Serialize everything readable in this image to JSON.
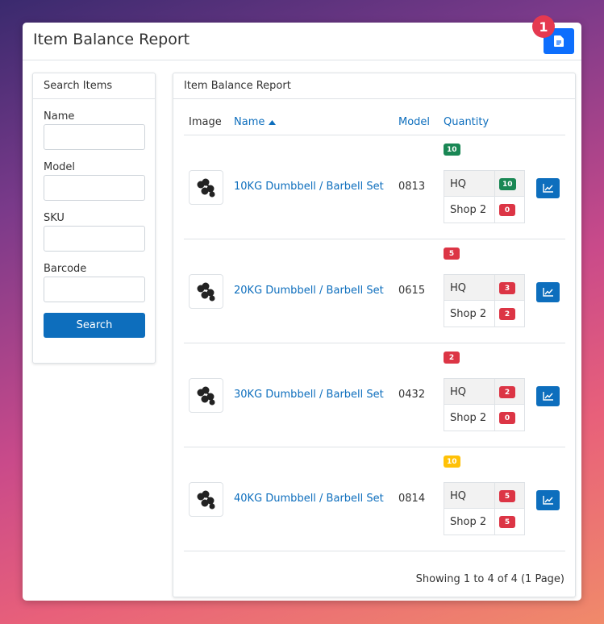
{
  "header": {
    "title": "Item Balance Report",
    "notification_count": "1"
  },
  "search": {
    "title": "Search Items",
    "fields": [
      {
        "label": "Name",
        "value": "",
        "placeholder": ""
      },
      {
        "label": "Model",
        "value": "",
        "placeholder": ""
      },
      {
        "label": "SKU",
        "value": "",
        "placeholder": ""
      },
      {
        "label": "Barcode",
        "value": "",
        "placeholder": ""
      }
    ],
    "button_label": "Search"
  },
  "report": {
    "title": "Item Balance Report",
    "columns": {
      "image": "Image",
      "name": "Name",
      "model": "Model",
      "quantity": "Quantity"
    },
    "sort_indicator": "ascending",
    "rows": [
      {
        "name": "10KG Dumbbell / Barbell Set",
        "model": "0813",
        "total": "10",
        "total_status": "success",
        "locations": [
          {
            "location": "HQ",
            "qty": "10",
            "status": "success"
          },
          {
            "location": "Shop 2",
            "qty": "0",
            "status": "danger"
          }
        ]
      },
      {
        "name": "20KG Dumbbell / Barbell Set",
        "model": "0615",
        "total": "5",
        "total_status": "danger",
        "locations": [
          {
            "location": "HQ",
            "qty": "3",
            "status": "danger"
          },
          {
            "location": "Shop 2",
            "qty": "2",
            "status": "danger"
          }
        ]
      },
      {
        "name": "30KG Dumbbell / Barbell Set",
        "model": "0432",
        "total": "2",
        "total_status": "danger",
        "locations": [
          {
            "location": "HQ",
            "qty": "2",
            "status": "danger"
          },
          {
            "location": "Shop 2",
            "qty": "0",
            "status": "danger"
          }
        ]
      },
      {
        "name": "40KG Dumbbell / Barbell Set",
        "model": "0814",
        "total": "10",
        "total_status": "warning",
        "locations": [
          {
            "location": "HQ",
            "qty": "5",
            "status": "danger"
          },
          {
            "location": "Shop 2",
            "qty": "5",
            "status": "danger"
          }
        ]
      }
    ],
    "pagination_text": "Showing 1 to 4 of 4 (1 Page)"
  },
  "icons": {
    "export": "file-export-icon",
    "sort": "sort-up-icon",
    "chart": "line-chart-icon",
    "product": "dumbbell-icon"
  },
  "colors": {
    "primary": "#0d6efd",
    "link": "#0d6ebd",
    "success": "#198754",
    "danger": "#dc3545",
    "warning": "#ffc107",
    "notification": "#e53950"
  }
}
